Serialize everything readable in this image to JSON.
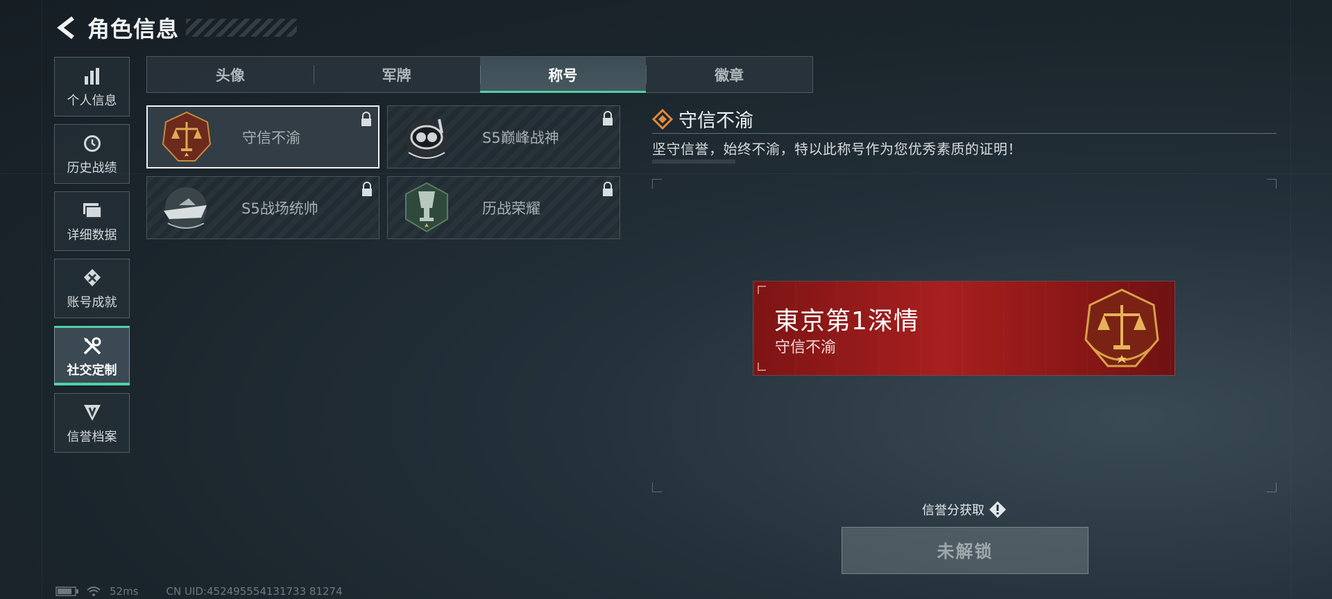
{
  "header": {
    "title": "角色信息"
  },
  "sidebar": {
    "items": [
      {
        "label": "个人信息",
        "icon": "bar-chart-icon"
      },
      {
        "label": "历史战绩",
        "icon": "history-icon"
      },
      {
        "label": "详细数据",
        "icon": "folder-icon"
      },
      {
        "label": "账号成就",
        "icon": "achievement-icon"
      },
      {
        "label": "社交定制",
        "icon": "tools-icon",
        "active": true
      },
      {
        "label": "信誉档案",
        "icon": "reputation-icon"
      }
    ]
  },
  "tabs": [
    {
      "label": "头像"
    },
    {
      "label": "军牌"
    },
    {
      "label": "称号",
      "active": true
    },
    {
      "label": "徽章"
    }
  ],
  "titles": [
    {
      "name": "守信不渝",
      "emblem": "scales-emblem",
      "locked": true,
      "selected": true
    },
    {
      "name": "S5巅峰战神",
      "emblem": "diver-emblem",
      "locked": true
    },
    {
      "name": "S5战场统帅",
      "emblem": "boat-emblem",
      "locked": true
    },
    {
      "name": "历战荣耀",
      "emblem": "trophy-emblem",
      "locked": true
    }
  ],
  "detail": {
    "title": "守信不渝",
    "description": "坚守信誉，始终不渝，特以此称号作为您优秀素质的证明！"
  },
  "banner": {
    "player_name": "東京第1深情",
    "title": "守信不渝"
  },
  "actions": {
    "credit_link": "信誉分获取",
    "unlock_button": "未解锁"
  },
  "status": {
    "ping": "52ms",
    "uid": "CN UID:452495554131733 81274"
  },
  "colors": {
    "accent": "#4fd1a5",
    "banner_red": "#a81f1f",
    "gold": "#c98a3a"
  }
}
